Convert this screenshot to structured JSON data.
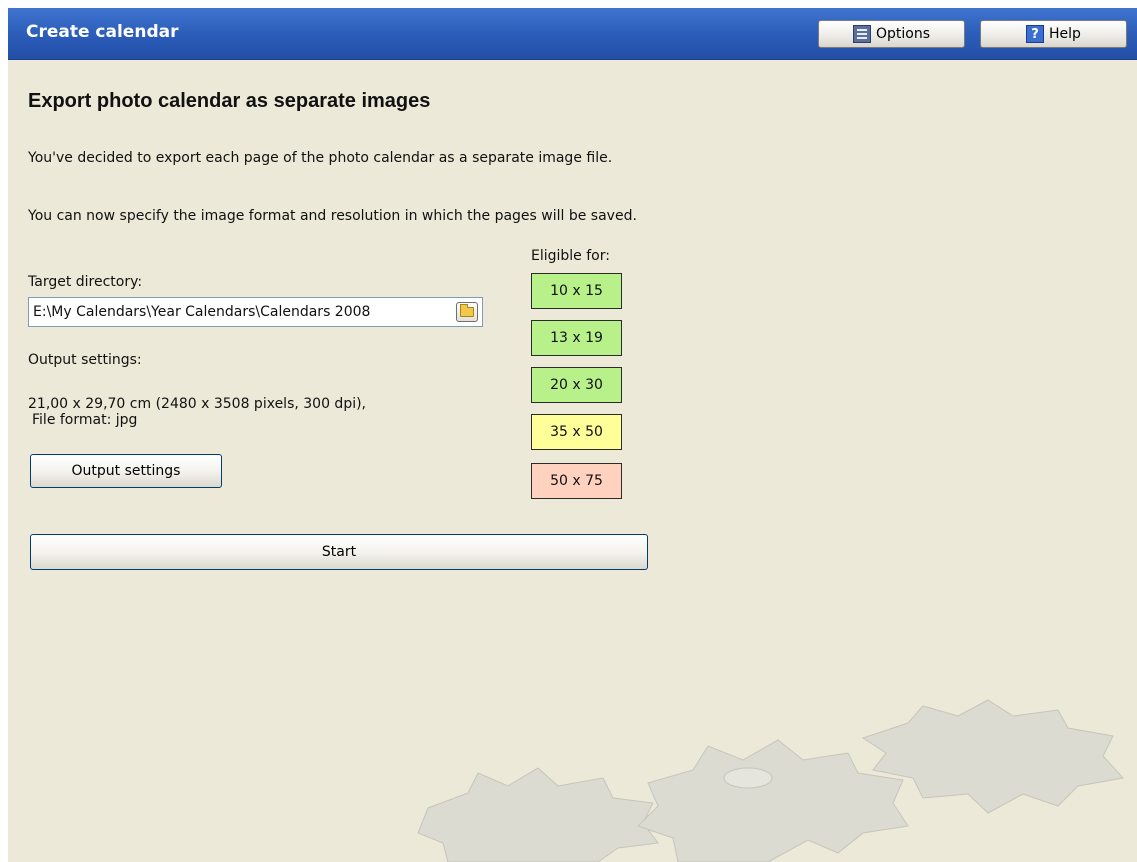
{
  "titlebar": {
    "title": "Create calendar",
    "options_label": "Options",
    "help_label": "Help"
  },
  "heading": "Export photo calendar as separate images",
  "intro": "You've decided to export each page of the photo calendar as a separate image file.",
  "instructions": "You can now specify the image format and resolution in which the pages will be saved.",
  "target_directory": {
    "label": "Target directory:",
    "value": "E:\\My Calendars\\Year Calendars\\Calendars 2008"
  },
  "output": {
    "label": "Output settings:",
    "summary_line1": "21,00 x 29,70 cm (2480 x 3508 pixels, 300 dpi),",
    "summary_line2": "File format: jpg",
    "button_label": "Output settings"
  },
  "eligible": {
    "label": "Eligible for:",
    "sizes": [
      {
        "label": "10 x 15",
        "color": "#b8f08a"
      },
      {
        "label": "13 x 19",
        "color": "#b8f08a"
      },
      {
        "label": "20 x 30",
        "color": "#b8f08a"
      },
      {
        "label": "35 x 50",
        "color": "#ffff99"
      },
      {
        "label": "50 x 75",
        "color": "#ffd2c0"
      }
    ]
  },
  "start_label": "Start",
  "colors": {
    "titlebar": "#2a5cb8",
    "background": "#ece9d8"
  }
}
